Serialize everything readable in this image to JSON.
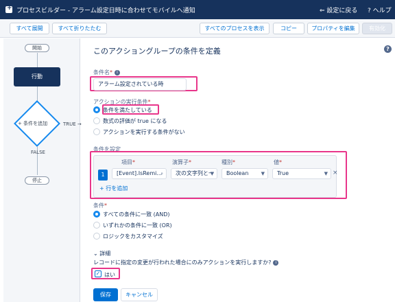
{
  "header": {
    "title": "プロセスビルダー - アラーム設定日時に合わせてモバイルへ通知",
    "back": "設定に戻る",
    "help": "ヘルプ"
  },
  "toolbar": {
    "expand_all": "すべて展開",
    "collapse_all": "すべて折りたたむ",
    "show_all": "すべてのプロセスを表示",
    "copy": "コピー",
    "edit_properties": "プロパティを編集",
    "activate": "有効化"
  },
  "canvas": {
    "start": "開始",
    "action": "行動",
    "add_criteria": "条件を追加",
    "true_label": "TRUE",
    "false_label": "FALSE",
    "stop": "停止"
  },
  "panel": {
    "title": "このアクショングループの条件を定義",
    "criteria_name_label": "条件名",
    "criteria_name_value": "アラーム設定されている時",
    "exec_label": "アクションの実行条件",
    "exec_options": [
      "条件を満たしている",
      "数式の評価が true になる",
      "アクションを実行する条件がない"
    ],
    "set_conditions_label": "条件を設定",
    "columns": {
      "field": "項目",
      "operator": "演算子",
      "type": "種別",
      "value": "値"
    },
    "row": {
      "num": "1",
      "field": "[Event].IsRemi...",
      "operator": "次の文字列と一",
      "type": "Boolean",
      "value": "True"
    },
    "add_row": "行を追加",
    "logic_label": "条件",
    "logic_options": [
      "すべての条件に一致 (AND)",
      "いずれかの条件に一致 (OR)",
      "ロジックをカスタマイズ"
    ],
    "details": "詳細",
    "changes_question": "レコードに指定の変更が行われた場合にのみアクションを実行しますか?",
    "yes": "はい",
    "save": "保存",
    "cancel": "キャンセル"
  }
}
